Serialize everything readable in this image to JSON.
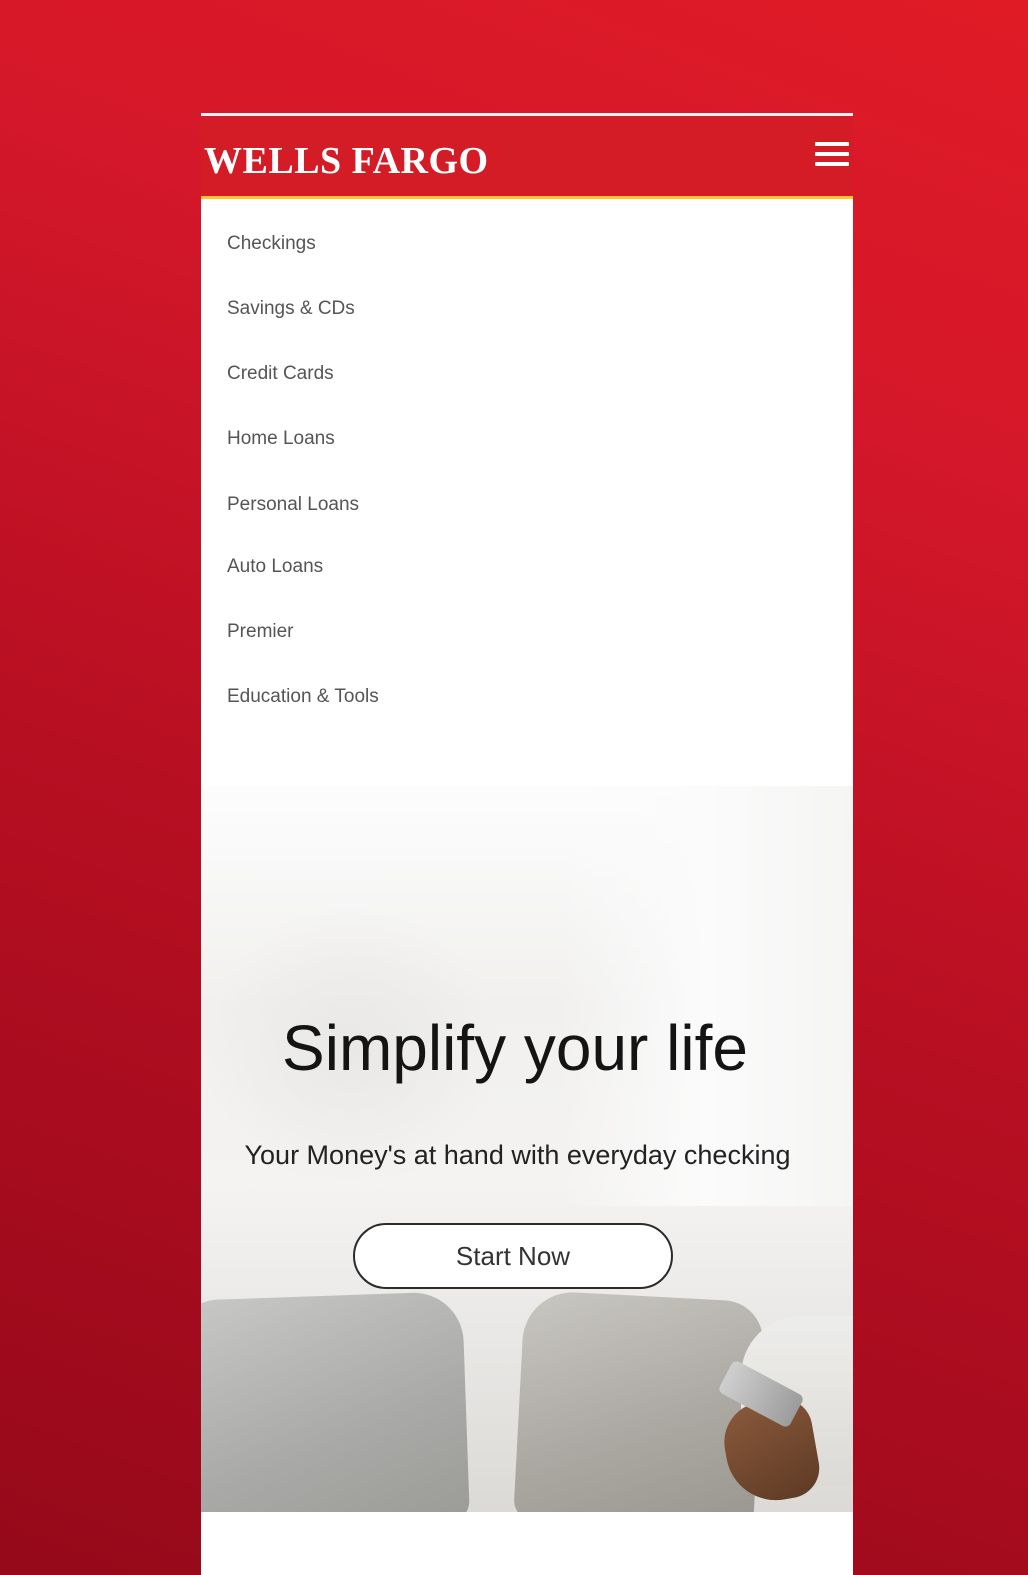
{
  "header": {
    "brand": "WELLS FARGO",
    "menu_icon": "hamburger-menu-icon",
    "brand_color": "#d31c26",
    "accent_stripe_color": "#ffc72c"
  },
  "nav": {
    "items": [
      {
        "label": "Checkings"
      },
      {
        "label": "Savings & CDs"
      },
      {
        "label": "Credit Cards"
      },
      {
        "label": "Home Loans"
      },
      {
        "label": "Personal Loans"
      },
      {
        "label": "Auto Loans"
      },
      {
        "label": "Premier"
      },
      {
        "label": "Education & Tools"
      }
    ]
  },
  "hero": {
    "title": "Simplify your life",
    "subtitle": "Your Money's at hand with everyday checking",
    "cta_label": "Start Now"
  }
}
